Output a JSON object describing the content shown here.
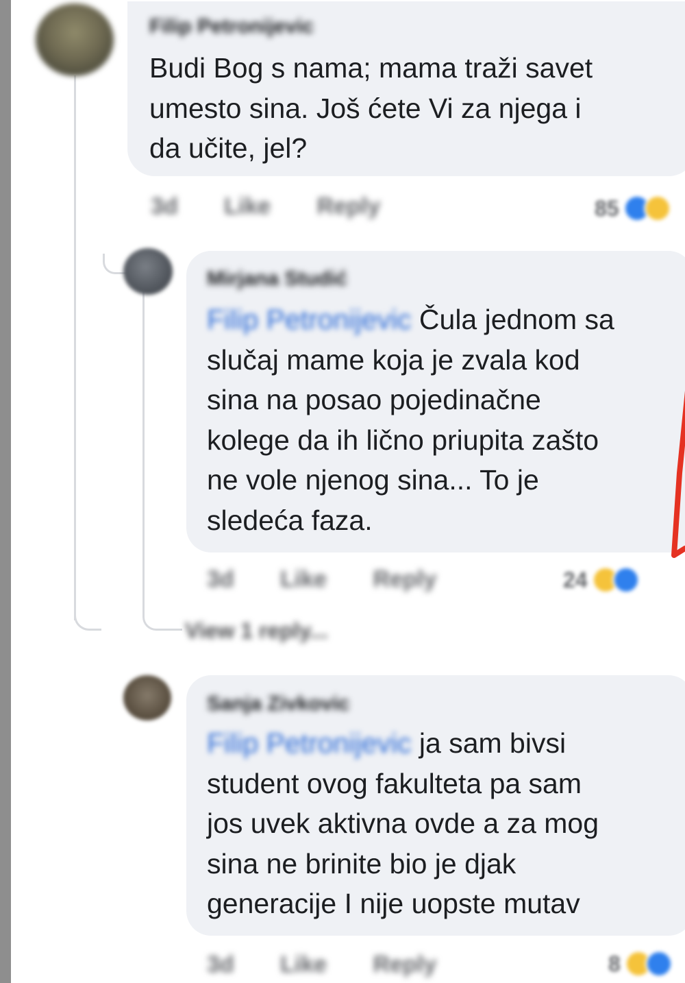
{
  "comments": [
    {
      "author": "Filip Petronijevic",
      "lines": [
        "Budi Bog s nama; mama traži savet",
        "umesto sina. Još ćete Vi za njega i",
        "da učite, jel?"
      ],
      "time": "3d",
      "like": "Like",
      "reply": "Reply",
      "reaction_count": "85"
    },
    {
      "author": "Mirjana Studić",
      "mention": "Filip Petronijevic",
      "first_line_rest": "Čula jednom sa",
      "lines": [
        "slučaj mame koja je zvala kod",
        "sina na posao pojedinačne",
        "kolege da ih lično priupita zašto",
        "ne vole njenog sina... To je",
        "sledeća faza."
      ],
      "time": "3d",
      "like": "Like",
      "reply": "Reply",
      "reaction_count": "24"
    },
    {
      "author": "Sanja Zivkovic",
      "mention": "Filip Petronijevic",
      "first_line_rest": "ja sam bivsi",
      "lines": [
        "student ovog fakulteta pa sam",
        "jos uvek aktivna ovde a za mog",
        "sina ne brinite bio je djak",
        "generacije I nije uopste mutav"
      ],
      "time": "3d",
      "like": "Like",
      "reply": "Reply",
      "reaction_count": "8"
    }
  ],
  "view_replies": "View 1 reply...",
  "colors": {
    "mention": "#2a6ad7",
    "bubble": "#eff1f5",
    "arrow": "#e53222"
  },
  "icons": [
    "like-reaction-icon",
    "haha-reaction-icon"
  ]
}
